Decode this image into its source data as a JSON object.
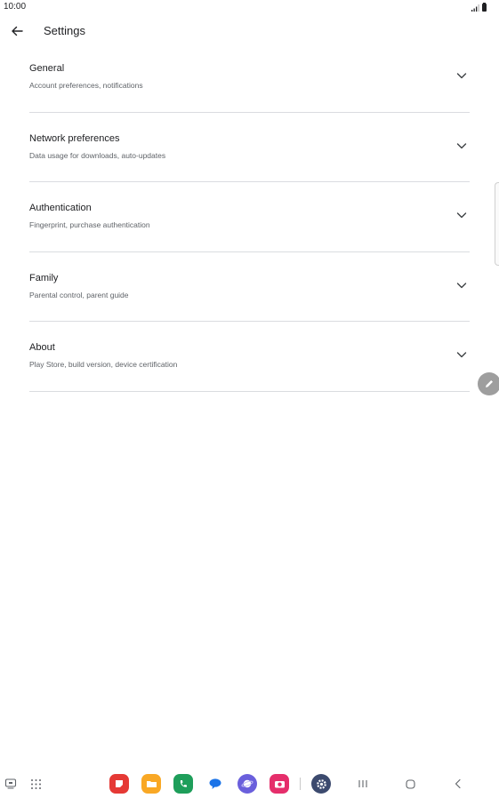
{
  "status_bar": {
    "time": "10:00"
  },
  "app_bar": {
    "title": "Settings"
  },
  "settings": [
    {
      "title": "General",
      "subtitle": "Account preferences, notifications"
    },
    {
      "title": "Network preferences",
      "subtitle": "Data usage for downloads, auto-updates"
    },
    {
      "title": "Authentication",
      "subtitle": "Fingerprint, purchase authentication"
    },
    {
      "title": "Family",
      "subtitle": "Parental control, parent guide"
    },
    {
      "title": "About",
      "subtitle": "Play Store, build version, device certification"
    }
  ],
  "dock": {
    "apps": [
      {
        "icon": "notes-app-icon",
        "color": "#e53935"
      },
      {
        "icon": "files-app-icon",
        "color": "#f9a825"
      },
      {
        "icon": "phone-app-icon",
        "color": "#1e9e5a"
      },
      {
        "icon": "messages-app-icon",
        "color": "#1a73e8"
      },
      {
        "icon": "browser-app-icon",
        "color": "#6a5fdc"
      },
      {
        "icon": "camera-app-icon",
        "color": "#e52e6b"
      },
      {
        "icon": "settings-app-icon",
        "color": "#3c4a6e"
      }
    ]
  }
}
